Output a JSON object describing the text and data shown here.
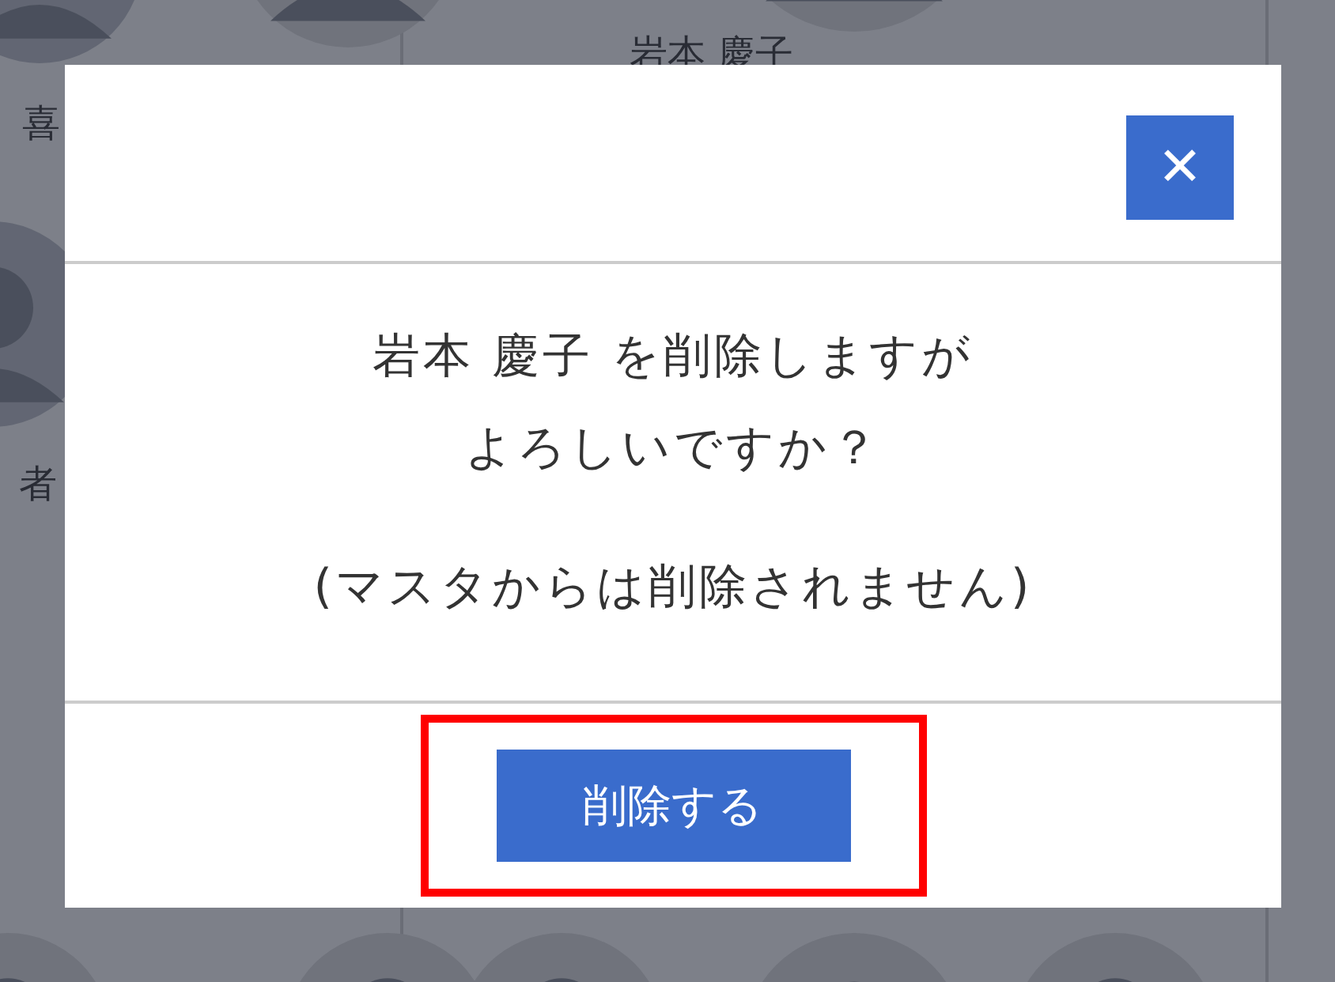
{
  "background": {
    "labels": [
      "喜",
      "岩本 慶子",
      "者"
    ]
  },
  "dialog": {
    "close_label": "✕",
    "paragraphs": [
      [
        "岩本 慶子 を削除しますが",
        "よろしいですか？"
      ],
      [
        "(マスタからは削除されません)"
      ]
    ],
    "button": {
      "label": "削除する",
      "highlighted": true
    }
  }
}
